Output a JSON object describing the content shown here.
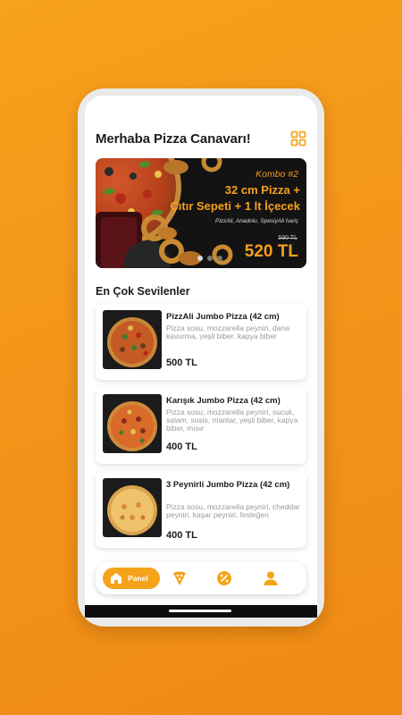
{
  "header": {
    "greeting": "Merhaba Pizza Canavarı!"
  },
  "banner": {
    "kombo": "Kombo #2",
    "title_line1": "32 cm Pizza +",
    "title_line2": "Çıtır Sepeti + 1 lt İçecek",
    "note": "PizzAli, Anadolu, SpesiyAli hariç",
    "old_price": "590 TL",
    "price": "520 TL",
    "slide_count": 3,
    "active_slide": 1
  },
  "section": {
    "title": "En Çok Sevilenler"
  },
  "products": [
    {
      "name": "PizzAli Jumbo Pizza (42 cm)",
      "description": "Pizza sosu, mozzarella peyniri, dana kavurma, yeşil biber, kapya biber",
      "price": "500 TL"
    },
    {
      "name": "Karışık Jumbo Pizza (42 cm)",
      "description": "Pizza sosu, mozzarella peyniri, sucuk, salam, sosis, mantar, yeşil biber, kapya biber, mısır",
      "price": "400 TL"
    },
    {
      "name": "3 Peynirli Jumbo Pizza (42 cm)",
      "description": "Pizza sosu, mozzarella peyniri, cheddar peyniri, kaşar peyniri, fesleğen",
      "price": "400 TL"
    }
  ],
  "navbar": {
    "panel_label": "Panel",
    "icons": [
      "home-icon",
      "pizza-slice-icon",
      "discount-icon",
      "user-icon"
    ]
  },
  "colors": {
    "accent": "#f5a31a",
    "text": "#1d1d1d",
    "muted": "#9a9a9a"
  }
}
